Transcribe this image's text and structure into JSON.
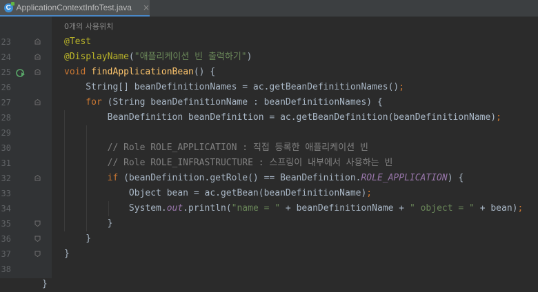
{
  "tab": {
    "title": "ApplicationContextInfoTest.java",
    "close": "×"
  },
  "usage_hint": "0개의 사용위치",
  "lines": [
    {
      "num": "23",
      "t": [
        [
          "ann",
          "@Test"
        ]
      ]
    },
    {
      "num": "24",
      "t": [
        [
          "ann",
          "@DisplayName"
        ],
        [
          "plain",
          "("
        ],
        [
          "str",
          "\"애플리케이션 빈 출력하기\""
        ],
        [
          "plain",
          ")"
        ]
      ]
    },
    {
      "num": "25",
      "t": [
        [
          "kw",
          "void "
        ],
        [
          "fn",
          "findApplicationBean"
        ],
        [
          "plain",
          "() {"
        ]
      ]
    },
    {
      "num": "26",
      "t": [
        [
          "plain",
          "    String[] beanDefinitionNames = ac.getBeanDefinitionNames()"
        ],
        [
          "kw",
          ";"
        ]
      ]
    },
    {
      "num": "27",
      "t": [
        [
          "kw",
          "    for "
        ],
        [
          "plain",
          "(String beanDefinitionName : beanDefinitionNames) {"
        ]
      ]
    },
    {
      "num": "28",
      "t": [
        [
          "plain",
          "        BeanDefinition beanDefinition = ac.getBeanDefinition(beanDefinitionName)"
        ],
        [
          "kw",
          ";"
        ]
      ]
    },
    {
      "num": "29",
      "t": []
    },
    {
      "num": "30",
      "t": [
        [
          "cmt",
          "        // Role ROLE_APPLICATION : 직접 등록한 애플리케이션 빈"
        ]
      ]
    },
    {
      "num": "31",
      "t": [
        [
          "cmt",
          "        // Role ROLE_INFRASTRUCTURE : 스프링이 내부에서 사용하는 빈"
        ]
      ]
    },
    {
      "num": "32",
      "t": [
        [
          "kw",
          "        if "
        ],
        [
          "plain",
          "(beanDefinition.getRole() == BeanDefinition."
        ],
        [
          "sfld",
          "ROLE_APPLICATION"
        ],
        [
          "plain",
          ") {"
        ]
      ]
    },
    {
      "num": "33",
      "t": [
        [
          "plain",
          "            Object bean = ac.getBean(beanDefinitionName)"
        ],
        [
          "kw",
          ";"
        ]
      ]
    },
    {
      "num": "34",
      "t": [
        [
          "plain",
          "            System."
        ],
        [
          "fld",
          "out"
        ],
        [
          "plain",
          ".println("
        ],
        [
          "str",
          "\"name = \""
        ],
        [
          "plain",
          " + beanDefinitionName + "
        ],
        [
          "str",
          "\" object = \""
        ],
        [
          "plain",
          " + bean)"
        ],
        [
          "kw",
          ";"
        ]
      ]
    },
    {
      "num": "35",
      "t": [
        [
          "plain",
          "        }"
        ]
      ]
    },
    {
      "num": "36",
      "t": [
        [
          "plain",
          "    }"
        ]
      ]
    },
    {
      "num": "37",
      "t": [
        [
          "plain",
          "}"
        ]
      ]
    },
    {
      "num": "38",
      "t": []
    },
    {
      "num": "",
      "t": [
        [
          "plain",
          "}"
        ]
      ]
    }
  ]
}
